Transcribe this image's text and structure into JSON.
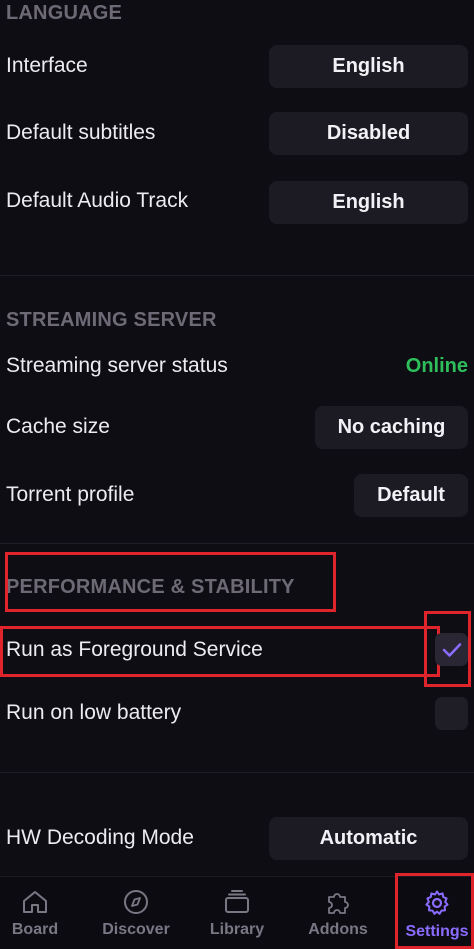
{
  "language": {
    "title": "LANGUAGE",
    "interface_label": "Interface",
    "interface_value": "English",
    "subtitles_label": "Default subtitles",
    "subtitles_value": "Disabled",
    "audio_label": "Default Audio Track",
    "audio_value": "English"
  },
  "streaming": {
    "title": "STREAMING SERVER",
    "status_label": "Streaming server status",
    "status_value": "Online",
    "cache_label": "Cache size",
    "cache_value": "No caching",
    "torrent_label": "Torrent profile",
    "torrent_value": "Default"
  },
  "performance": {
    "title": "PERFORMANCE & STABILITY",
    "foreground_label": "Run as Foreground Service",
    "foreground_checked": true,
    "battery_label": "Run on low battery",
    "battery_checked": false
  },
  "hw": {
    "label": "HW Decoding Mode",
    "value": "Automatic"
  },
  "nav": {
    "board": "Board",
    "discover": "Discover",
    "library": "Library",
    "addons": "Addons",
    "settings": "Settings",
    "active": "Settings"
  },
  "colors": {
    "accent": "#8a6cff",
    "online": "#2fbf5a",
    "highlight": "#e0242c"
  }
}
